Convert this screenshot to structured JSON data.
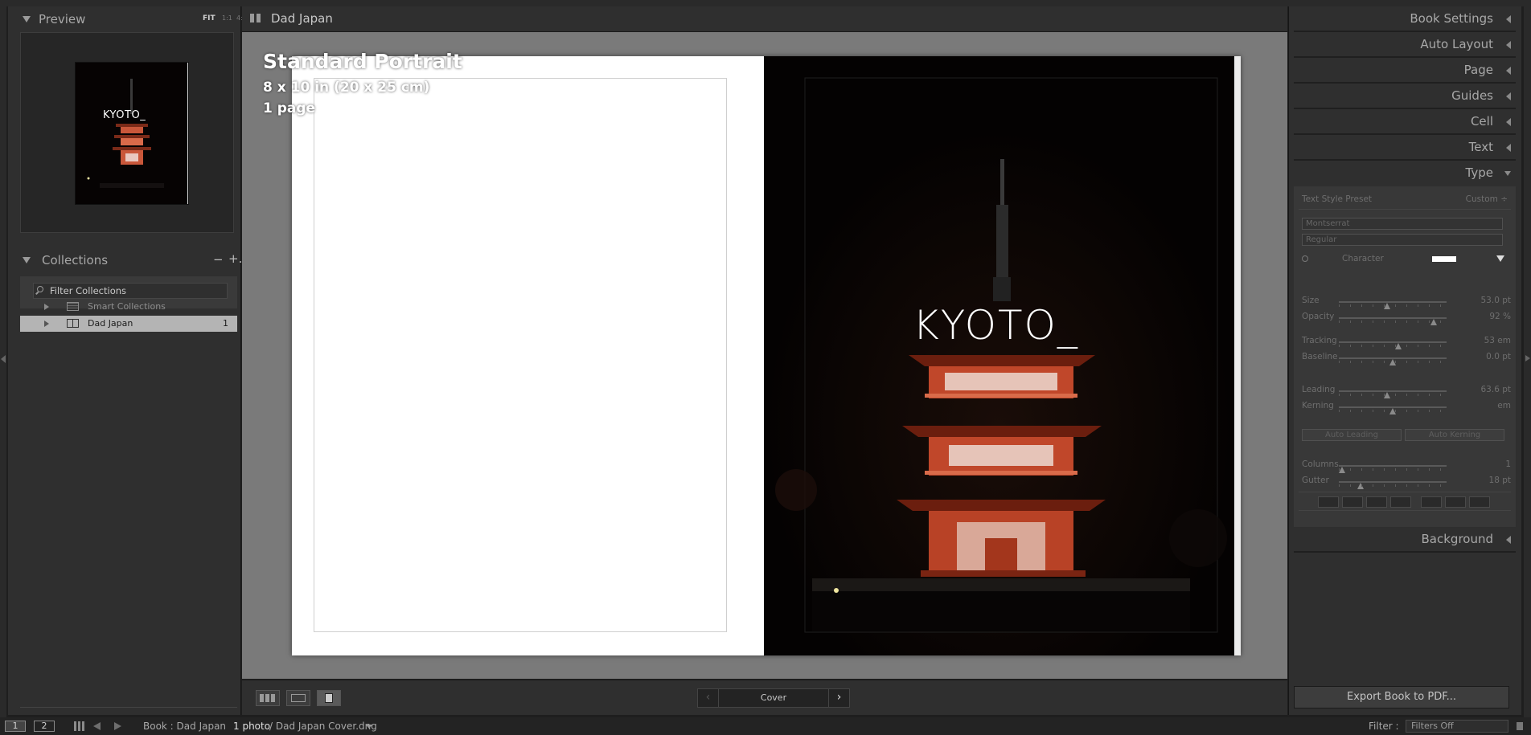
{
  "left_panel": {
    "preview": {
      "title": "Preview",
      "zoom_fit": "FIT",
      "zoom_1_1": "1:1",
      "zoom_4_1": "4:1",
      "thumb_text": "KYOTO_"
    },
    "collections": {
      "title": "Collections",
      "minus": "−",
      "plus": "+.",
      "filter_placeholder": "Filter Collections",
      "items": [
        {
          "label": "Smart Collections",
          "count": ""
        },
        {
          "label": "Dad Japan",
          "count": "1"
        }
      ]
    }
  },
  "center": {
    "header_title": "Dad Japan",
    "book_info": {
      "size_name": "Standard Portrait",
      "dimensions": "8 x 10 in (20 x 25 cm)",
      "pages": "1 page"
    },
    "cover_text": "KYOTO_",
    "nav": {
      "page_label": "Cover",
      "prev": "‹",
      "next": "›"
    }
  },
  "right_panel": {
    "sections": [
      "Book Settings",
      "Auto Layout",
      "Page",
      "Guides",
      "Cell",
      "Text",
      "Type",
      "Background"
    ],
    "type": {
      "preset_label": "Text Style Preset",
      "preset_value": "Custom ÷",
      "font": "Montserrat",
      "style": "Regular",
      "character_label": "Character",
      "rows": [
        {
          "label": "Size",
          "value": "53.0 pt",
          "pos": 0.45
        },
        {
          "label": "Opacity",
          "value": "92 %",
          "pos": 0.88
        },
        {
          "label": "Tracking",
          "value": "53 em",
          "pos": 0.55
        },
        {
          "label": "Baseline",
          "value": "0.0 pt",
          "pos": 0.5
        },
        {
          "label": "Leading",
          "value": "63.6 pt",
          "pos": 0.45
        },
        {
          "label": "Kerning",
          "value": "em",
          "pos": 0.5
        },
        {
          "label": "Columns",
          "value": "1",
          "pos": 0.03
        },
        {
          "label": "Gutter",
          "value": "18 pt",
          "pos": 0.2
        }
      ],
      "auto_leading": "Auto Leading",
      "auto_kerning": "Auto Kerning"
    },
    "export_label": "Export Book to PDF..."
  },
  "filmstrip": {
    "monitor_1": "1",
    "monitor_2": "2",
    "source": "Book : Dad Japan",
    "photo_count": "1 photo",
    "filename": "/ Dad Japan Cover.dng",
    "filter_label": "Filter :",
    "filter_value": "Filters Off"
  }
}
